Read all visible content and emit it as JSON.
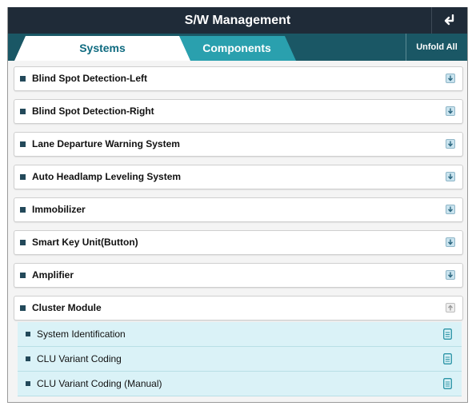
{
  "header": {
    "title": "S/W Management",
    "back_icon": "return-arrow-icon"
  },
  "tabs": [
    {
      "label": "Systems",
      "active": true
    },
    {
      "label": "Components",
      "active": false
    }
  ],
  "unfold_label": "Unfold All",
  "systems": [
    {
      "label": "Blind Spot Detection-Left",
      "state": "collapsed"
    },
    {
      "label": "Blind Spot Detection-Right",
      "state": "collapsed"
    },
    {
      "label": "Lane Departure Warning System",
      "state": "collapsed"
    },
    {
      "label": "Auto Headlamp Leveling System",
      "state": "collapsed"
    },
    {
      "label": "Immobilizer",
      "state": "collapsed"
    },
    {
      "label": "Smart Key Unit(Button)",
      "state": "collapsed"
    },
    {
      "label": "Amplifier",
      "state": "collapsed"
    },
    {
      "label": "Cluster Module",
      "state": "expanded"
    }
  ],
  "cluster_items": [
    {
      "label": "System Identification"
    },
    {
      "label": "CLU Variant Coding"
    },
    {
      "label": "CLU Variant Coding (Manual)"
    }
  ],
  "colors": {
    "header": "#1f2b38",
    "tab_bar": "#1a5765",
    "active_tab_text": "#0f6b80",
    "inactive_tab": "#2aa0ae",
    "sub_item_bg": "#daf2f7"
  }
}
